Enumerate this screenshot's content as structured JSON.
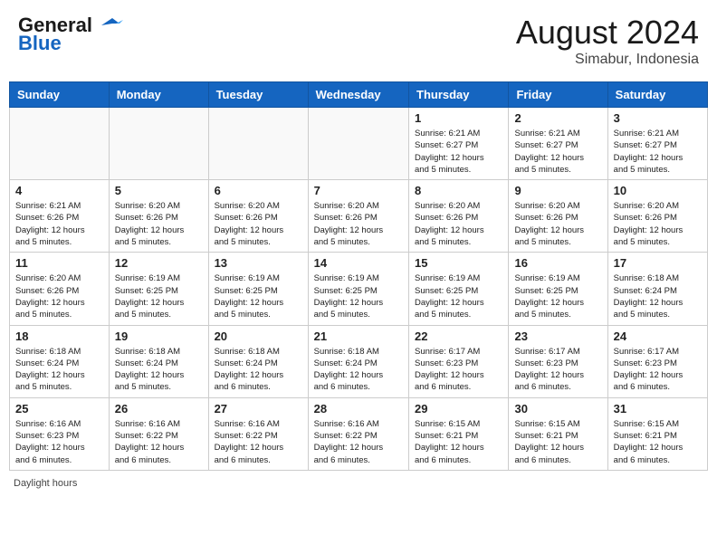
{
  "header": {
    "logo_general": "General",
    "logo_blue": "Blue",
    "month_year": "August 2024",
    "location": "Simabur, Indonesia"
  },
  "footer": {
    "label": "Daylight hours"
  },
  "columns": [
    "Sunday",
    "Monday",
    "Tuesday",
    "Wednesday",
    "Thursday",
    "Friday",
    "Saturday"
  ],
  "weeks": [
    [
      {
        "day": "",
        "info": ""
      },
      {
        "day": "",
        "info": ""
      },
      {
        "day": "",
        "info": ""
      },
      {
        "day": "",
        "info": ""
      },
      {
        "day": "1",
        "info": "Sunrise: 6:21 AM\nSunset: 6:27 PM\nDaylight: 12 hours\nand 5 minutes."
      },
      {
        "day": "2",
        "info": "Sunrise: 6:21 AM\nSunset: 6:27 PM\nDaylight: 12 hours\nand 5 minutes."
      },
      {
        "day": "3",
        "info": "Sunrise: 6:21 AM\nSunset: 6:27 PM\nDaylight: 12 hours\nand 5 minutes."
      }
    ],
    [
      {
        "day": "4",
        "info": "Sunrise: 6:21 AM\nSunset: 6:26 PM\nDaylight: 12 hours\nand 5 minutes."
      },
      {
        "day": "5",
        "info": "Sunrise: 6:20 AM\nSunset: 6:26 PM\nDaylight: 12 hours\nand 5 minutes."
      },
      {
        "day": "6",
        "info": "Sunrise: 6:20 AM\nSunset: 6:26 PM\nDaylight: 12 hours\nand 5 minutes."
      },
      {
        "day": "7",
        "info": "Sunrise: 6:20 AM\nSunset: 6:26 PM\nDaylight: 12 hours\nand 5 minutes."
      },
      {
        "day": "8",
        "info": "Sunrise: 6:20 AM\nSunset: 6:26 PM\nDaylight: 12 hours\nand 5 minutes."
      },
      {
        "day": "9",
        "info": "Sunrise: 6:20 AM\nSunset: 6:26 PM\nDaylight: 12 hours\nand 5 minutes."
      },
      {
        "day": "10",
        "info": "Sunrise: 6:20 AM\nSunset: 6:26 PM\nDaylight: 12 hours\nand 5 minutes."
      }
    ],
    [
      {
        "day": "11",
        "info": "Sunrise: 6:20 AM\nSunset: 6:26 PM\nDaylight: 12 hours\nand 5 minutes."
      },
      {
        "day": "12",
        "info": "Sunrise: 6:19 AM\nSunset: 6:25 PM\nDaylight: 12 hours\nand 5 minutes."
      },
      {
        "day": "13",
        "info": "Sunrise: 6:19 AM\nSunset: 6:25 PM\nDaylight: 12 hours\nand 5 minutes."
      },
      {
        "day": "14",
        "info": "Sunrise: 6:19 AM\nSunset: 6:25 PM\nDaylight: 12 hours\nand 5 minutes."
      },
      {
        "day": "15",
        "info": "Sunrise: 6:19 AM\nSunset: 6:25 PM\nDaylight: 12 hours\nand 5 minutes."
      },
      {
        "day": "16",
        "info": "Sunrise: 6:19 AM\nSunset: 6:25 PM\nDaylight: 12 hours\nand 5 minutes."
      },
      {
        "day": "17",
        "info": "Sunrise: 6:18 AM\nSunset: 6:24 PM\nDaylight: 12 hours\nand 5 minutes."
      }
    ],
    [
      {
        "day": "18",
        "info": "Sunrise: 6:18 AM\nSunset: 6:24 PM\nDaylight: 12 hours\nand 5 minutes."
      },
      {
        "day": "19",
        "info": "Sunrise: 6:18 AM\nSunset: 6:24 PM\nDaylight: 12 hours\nand 5 minutes."
      },
      {
        "day": "20",
        "info": "Sunrise: 6:18 AM\nSunset: 6:24 PM\nDaylight: 12 hours\nand 6 minutes."
      },
      {
        "day": "21",
        "info": "Sunrise: 6:18 AM\nSunset: 6:24 PM\nDaylight: 12 hours\nand 6 minutes."
      },
      {
        "day": "22",
        "info": "Sunrise: 6:17 AM\nSunset: 6:23 PM\nDaylight: 12 hours\nand 6 minutes."
      },
      {
        "day": "23",
        "info": "Sunrise: 6:17 AM\nSunset: 6:23 PM\nDaylight: 12 hours\nand 6 minutes."
      },
      {
        "day": "24",
        "info": "Sunrise: 6:17 AM\nSunset: 6:23 PM\nDaylight: 12 hours\nand 6 minutes."
      }
    ],
    [
      {
        "day": "25",
        "info": "Sunrise: 6:16 AM\nSunset: 6:23 PM\nDaylight: 12 hours\nand 6 minutes."
      },
      {
        "day": "26",
        "info": "Sunrise: 6:16 AM\nSunset: 6:22 PM\nDaylight: 12 hours\nand 6 minutes."
      },
      {
        "day": "27",
        "info": "Sunrise: 6:16 AM\nSunset: 6:22 PM\nDaylight: 12 hours\nand 6 minutes."
      },
      {
        "day": "28",
        "info": "Sunrise: 6:16 AM\nSunset: 6:22 PM\nDaylight: 12 hours\nand 6 minutes."
      },
      {
        "day": "29",
        "info": "Sunrise: 6:15 AM\nSunset: 6:21 PM\nDaylight: 12 hours\nand 6 minutes."
      },
      {
        "day": "30",
        "info": "Sunrise: 6:15 AM\nSunset: 6:21 PM\nDaylight: 12 hours\nand 6 minutes."
      },
      {
        "day": "31",
        "info": "Sunrise: 6:15 AM\nSunset: 6:21 PM\nDaylight: 12 hours\nand 6 minutes."
      }
    ]
  ]
}
